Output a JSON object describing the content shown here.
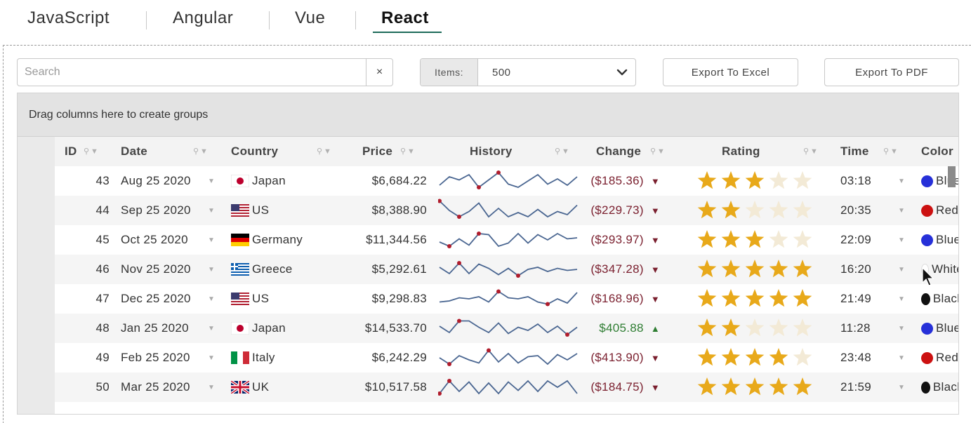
{
  "frameworks": {
    "tabs": [
      {
        "label": "JavaScript"
      },
      {
        "label": "Angular"
      },
      {
        "label": "Vue"
      },
      {
        "label": "React"
      }
    ],
    "active": "React"
  },
  "toolbar": {
    "search_placeholder": "Search",
    "search_value": "",
    "clear_label": "×",
    "items_label": "Items:",
    "items_value": "500",
    "export_excel": "Export To Excel",
    "export_pdf": "Export To PDF"
  },
  "grid": {
    "group_panel_text": "Drag columns here to create groups",
    "columns": [
      "ID",
      "Date",
      "Country",
      "Price",
      "History",
      "Change",
      "Rating",
      "Time",
      "Color"
    ],
    "colors": {
      "star": "#e8a91a",
      "star_empty": "#f3ead6",
      "neg": "#7a1f2e",
      "pos": "#2e7d32",
      "spark": "#4a6691",
      "spark_dot": "#b01c2c"
    },
    "rows": [
      {
        "id": "43",
        "date": "Aug 25 2020",
        "country": "Japan",
        "flag": "jp",
        "price": "$6,684.22",
        "history": [
          0.3,
          0.7,
          0.55,
          0.8,
          0.2,
          0.55,
          0.9,
          0.35,
          0.2,
          0.5,
          0.8,
          0.35,
          0.6,
          0.3,
          0.7
        ],
        "change": "($185.36)",
        "dir": "down",
        "rating": 3,
        "time": "03:18",
        "color": "Blue",
        "color_hex": "#2630d8"
      },
      {
        "id": "44",
        "date": "Sep 25 2020",
        "country": "US",
        "flag": "us",
        "price": "$8,388.90",
        "history": [
          0.95,
          0.5,
          0.2,
          0.45,
          0.85,
          0.2,
          0.6,
          0.2,
          0.4,
          0.2,
          0.55,
          0.2,
          0.45,
          0.3,
          0.75
        ],
        "change": "($229.73)",
        "dir": "down",
        "rating": 2,
        "time": "20:35",
        "color": "Red",
        "color_hex": "#cc1111"
      },
      {
        "id": "45",
        "date": "Oct 25 2020",
        "country": "Germany",
        "flag": "de",
        "price": "$11,344.56",
        "history": [
          0.4,
          0.2,
          0.55,
          0.25,
          0.8,
          0.75,
          0.2,
          0.35,
          0.8,
          0.35,
          0.75,
          0.5,
          0.8,
          0.55,
          0.6
        ],
        "change": "($293.97)",
        "dir": "down",
        "rating": 3,
        "time": "22:09",
        "color": "Blue",
        "color_hex": "#2630d8"
      },
      {
        "id": "46",
        "date": "Nov 25 2020",
        "country": "Greece",
        "flag": "gr",
        "price": "$5,292.61",
        "history": [
          0.6,
          0.3,
          0.8,
          0.3,
          0.75,
          0.55,
          0.25,
          0.55,
          0.2,
          0.5,
          0.6,
          0.4,
          0.55,
          0.45,
          0.5
        ],
        "change": "($347.28)",
        "dir": "down",
        "rating": 5,
        "time": "16:20",
        "color": "White",
        "color_hex": "#ffffff"
      },
      {
        "id": "47",
        "date": "Dec 25 2020",
        "country": "US",
        "flag": "us",
        "price": "$9,298.83",
        "history": [
          0.35,
          0.4,
          0.55,
          0.5,
          0.6,
          0.35,
          0.85,
          0.55,
          0.5,
          0.6,
          0.35,
          0.25,
          0.5,
          0.3,
          0.8
        ],
        "change": "($168.96)",
        "dir": "down",
        "rating": 5,
        "time": "21:49",
        "color": "Black",
        "color_hex": "#111111"
      },
      {
        "id": "48",
        "date": "Jan 25 2020",
        "country": "Japan",
        "flag": "jp",
        "price": "$14,533.70",
        "history": [
          0.6,
          0.3,
          0.85,
          0.85,
          0.55,
          0.3,
          0.75,
          0.25,
          0.55,
          0.4,
          0.7,
          0.3,
          0.6,
          0.2,
          0.55
        ],
        "change": "$405.88",
        "dir": "up",
        "rating": 2,
        "time": "11:28",
        "color": "Blue",
        "color_hex": "#2630d8"
      },
      {
        "id": "49",
        "date": "Feb 25 2020",
        "country": "Italy",
        "flag": "it",
        "price": "$6,242.29",
        "history": [
          0.5,
          0.2,
          0.6,
          0.4,
          0.25,
          0.85,
          0.3,
          0.7,
          0.25,
          0.55,
          0.6,
          0.2,
          0.65,
          0.4,
          0.7
        ],
        "change": "($413.90)",
        "dir": "down",
        "rating": 4,
        "time": "23:48",
        "color": "Red",
        "color_hex": "#cc1111"
      },
      {
        "id": "50",
        "date": "Mar 25 2020",
        "country": "UK",
        "flag": "uk",
        "price": "$10,517.58",
        "history": [
          0.2,
          0.8,
          0.3,
          0.75,
          0.2,
          0.7,
          0.2,
          0.75,
          0.35,
          0.8,
          0.3,
          0.8,
          0.5,
          0.8,
          0.2
        ],
        "change": "($184.75)",
        "dir": "down",
        "rating": 5,
        "time": "21:59",
        "color": "Black",
        "color_hex": "#111111"
      }
    ]
  }
}
